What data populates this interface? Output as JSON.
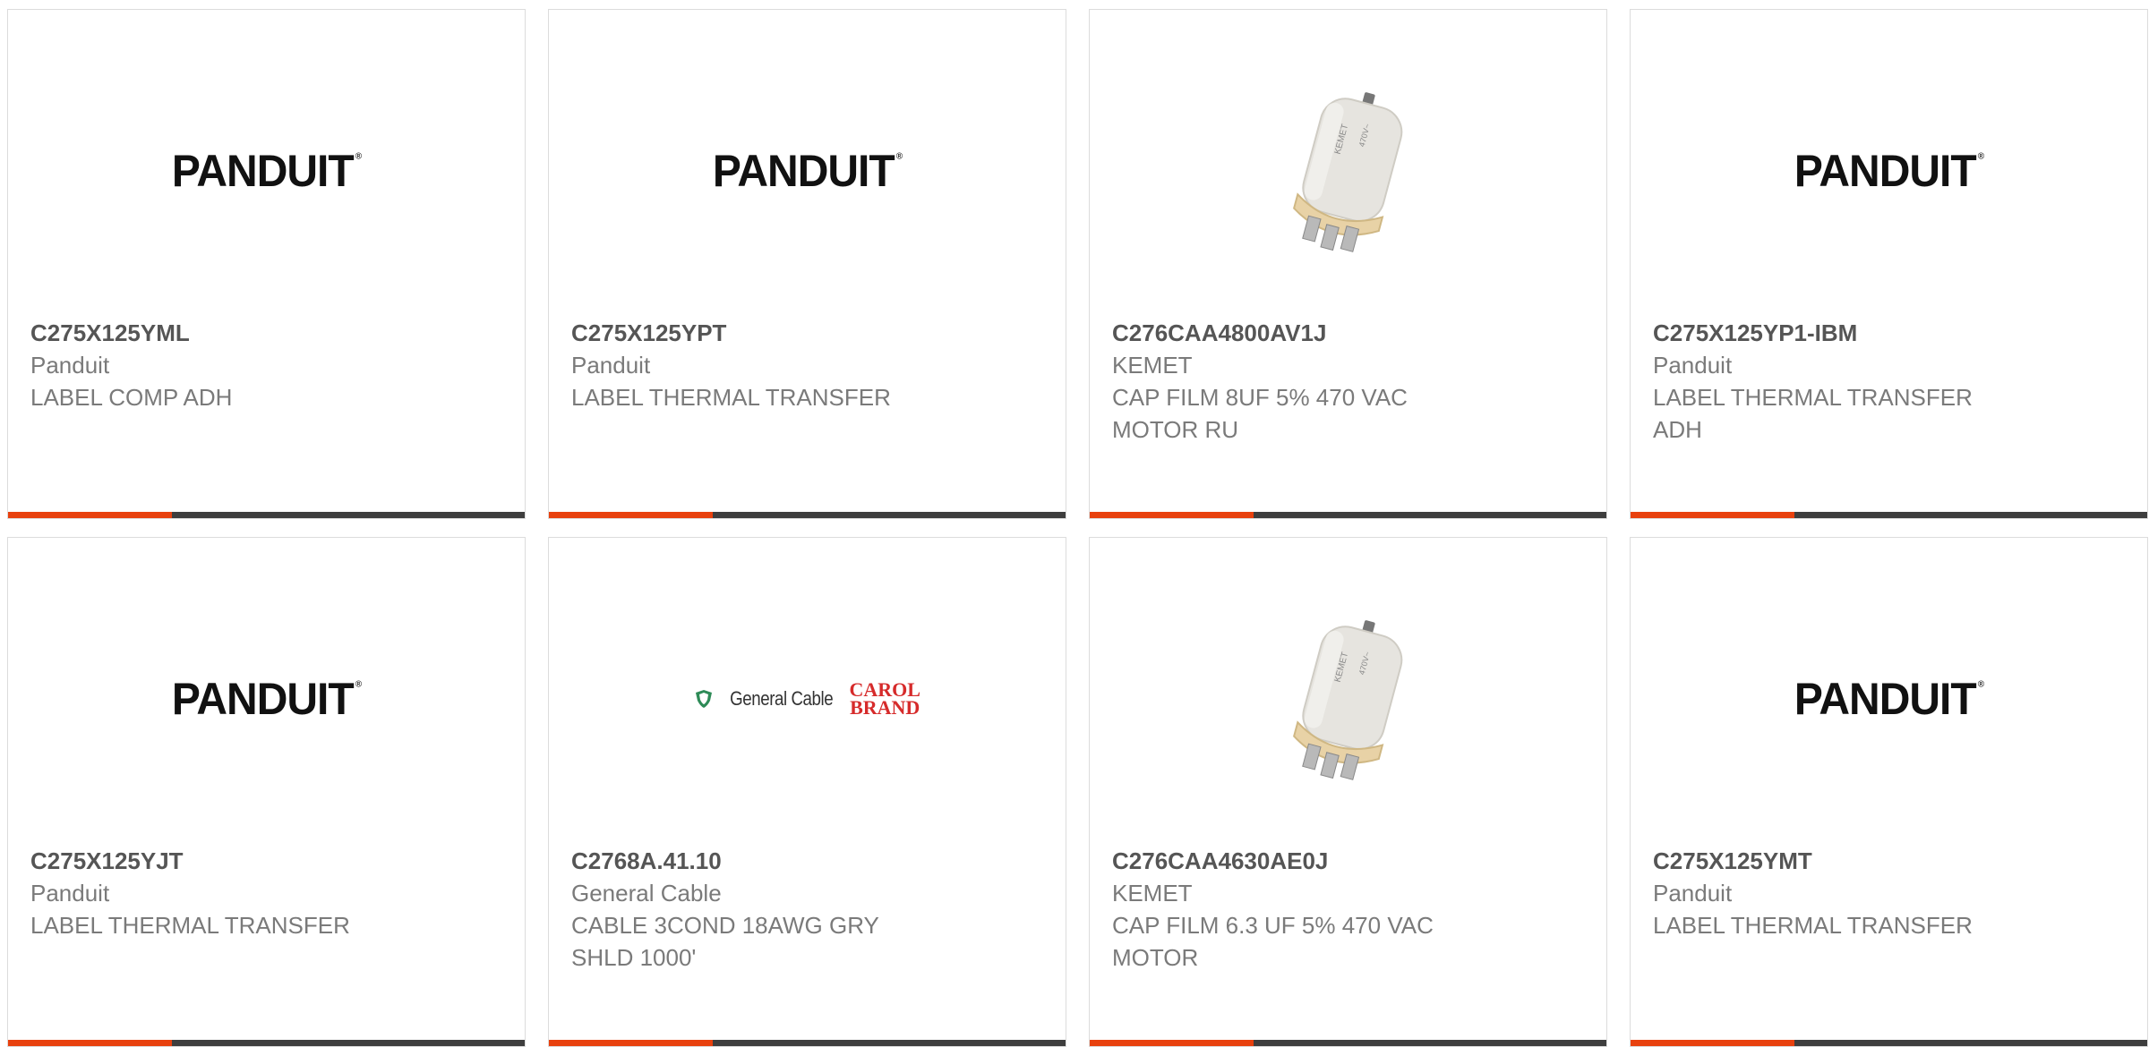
{
  "products": [
    {
      "part_number": "C275X125YML",
      "manufacturer": "Panduit",
      "description_line1": "LABEL COMP ADH",
      "description_line2": "",
      "image": "panduit-logo",
      "logo_text": "PANDUIT"
    },
    {
      "part_number": "C275X125YPT",
      "manufacturer": "Panduit",
      "description_line1": "LABEL THERMAL TRANSFER",
      "description_line2": "",
      "image": "panduit-logo",
      "logo_text": "PANDUIT"
    },
    {
      "part_number": "C276CAA4800AV1J",
      "manufacturer": "KEMET",
      "description_line1": "CAP FILM 8UF 5% 470 VAC",
      "description_line2": "MOTOR RU",
      "image": "capacitor-photo"
    },
    {
      "part_number": "C275X125YP1-IBM",
      "manufacturer": "Panduit",
      "description_line1": "LABEL THERMAL TRANSFER",
      "description_line2": "ADH",
      "image": "panduit-logo",
      "logo_text": "PANDUIT"
    },
    {
      "part_number": "C275X125YJT",
      "manufacturer": "Panduit",
      "description_line1": "LABEL THERMAL TRANSFER",
      "description_line2": "",
      "image": "panduit-logo",
      "logo_text": "PANDUIT"
    },
    {
      "part_number": "C2768A.41.10",
      "manufacturer": "General Cable",
      "description_line1": "CABLE 3COND 18AWG GRY",
      "description_line2": "SHLD 1000'",
      "image": "general-cable-logo",
      "logo_text": "General Cable",
      "logo_sub_line1": "CAROL",
      "logo_sub_line2": "BRAND"
    },
    {
      "part_number": "C276CAA4630AE0J",
      "manufacturer": "KEMET",
      "description_line1": "CAP FILM 6.3 UF 5% 470 VAC",
      "description_line2": "MOTOR",
      "image": "capacitor-photo"
    },
    {
      "part_number": "C275X125YMT",
      "manufacturer": "Panduit",
      "description_line1": "LABEL THERMAL TRANSFER",
      "description_line2": "",
      "image": "panduit-logo",
      "logo_text": "PANDUIT"
    }
  ],
  "colors": {
    "accent": "#e8410e",
    "bar": "#3e3e3e",
    "text": "#7a7a7a",
    "part_number": "#555555",
    "border": "#dcdcdc"
  }
}
